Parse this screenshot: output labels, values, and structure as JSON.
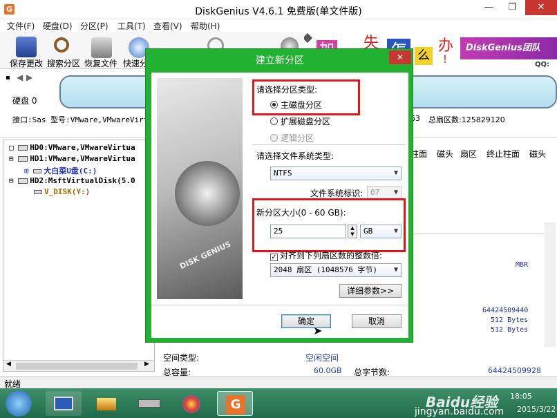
{
  "window": {
    "title": "DiskGenius V4.6.1 免费版(单文件版)",
    "logo_letter": "G",
    "controls": {
      "minimize": "—",
      "maximize": "❐",
      "close": "✕"
    }
  },
  "menu": [
    "文件(F)",
    "硬盘(D)",
    "分区(P)",
    "工具(T)",
    "查看(V)",
    "帮助(H)"
  ],
  "toolbar": {
    "buttons": [
      "保存更改",
      "搜索分区",
      "恢复文件",
      "快速分"
    ]
  },
  "banner": {
    "chars": [
      "加",
      "失",
      "怎",
      "么",
      "办",
      "!"
    ],
    "brand": "DiskGenius团队",
    "qq": "QQ:"
  },
  "disk_panel": {
    "disk_label": "硬盘 0",
    "interface_line": "接口:Sas  型号:VMware,VMwareVirt",
    "sectors_fragment": "63",
    "total_sectors": "总扇区数:125829120"
  },
  "tree": {
    "items": [
      {
        "label": "HD0:VMware,VMwareVirtua",
        "indent": 0,
        "expand": "□"
      },
      {
        "label": "HD1:VMware,VMwareVirtua",
        "indent": 0,
        "expand": "⊟"
      },
      {
        "label": "大白菜U盘(C:)",
        "indent": 1,
        "expand": "⊞"
      },
      {
        "label": "HD2:MsftVirtualDisk(5.0",
        "indent": 0,
        "expand": "⊟"
      },
      {
        "label": "V_DISK(Y:)",
        "indent": 1,
        "expand": ""
      }
    ]
  },
  "right_panel": {
    "columns": [
      "柱面",
      "磁头",
      "扇区",
      "终止柱面",
      "磁头"
    ],
    "mbr": "MBR",
    "values": [
      "64424509440",
      "512 Bytes",
      "512 Bytes"
    ]
  },
  "bottom_info": {
    "space_type_label": "空间类型:",
    "space_type_value": "空闲空间",
    "total_label": "总容量:",
    "total_value": "60.0GB",
    "total_bytes_label": "总字节数:",
    "total_bytes_value": "64424509928"
  },
  "status_bar": {
    "text": "就绪"
  },
  "taskbar": {
    "time": "18:05",
    "date": "2015/3/22",
    "watermark_url": "jingyan.baidu.com",
    "watermark_brand": "Baidu经验"
  },
  "dialog": {
    "title": "建立新分区",
    "close": "✕",
    "image_text": "DISK GENIUS",
    "partition_type_label": "请选择分区类型:",
    "partition_types": [
      {
        "label": "主磁盘分区",
        "checked": true,
        "disabled": false
      },
      {
        "label": "扩展磁盘分区",
        "checked": false,
        "disabled": false
      },
      {
        "label": "逻辑分区",
        "checked": false,
        "disabled": true
      }
    ],
    "fs_type_label": "请选择文件系统类型:",
    "fs_type_value": "NTFS",
    "fs_id_label": "文件系统标识:",
    "fs_id_value": "07",
    "size_label": "新分区大小(0 - 60 GB):",
    "size_value": "25",
    "size_unit": "GB",
    "align_label": "对齐到下列扇区数的整数倍:",
    "align_checked": true,
    "align_value": "2048 扇区 (1048576 字节)",
    "detail_button": "详细参数>>",
    "ok_button": "确定",
    "cancel_button": "取消"
  },
  "colors": {
    "dialog_frame": "#22b232",
    "highlight_box": "#e2161a",
    "taskbar": "#2a7a56",
    "close_button": "#c7372f"
  }
}
